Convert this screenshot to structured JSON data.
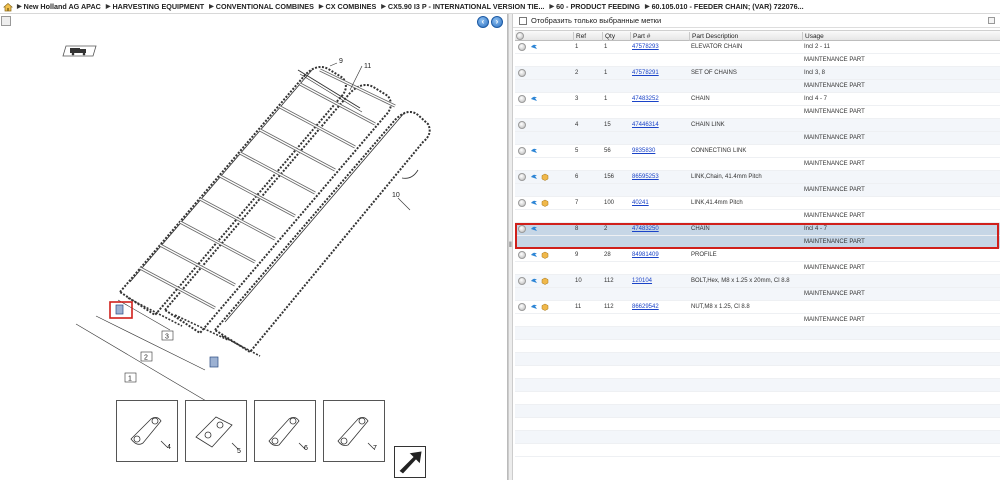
{
  "breadcrumb": [
    "New Holland AG APAC",
    "HARVESTING EQUIPMENT",
    "CONVENTIONAL COMBINES",
    "CX COMBINES",
    "CX5.90 I3 P - INTERNATIONAL VERSION TIE...",
    "60 - PRODUCT FEEDING",
    "60.105.010 - FEEDER CHAIN; (VAR) 722076..."
  ],
  "filter": {
    "label": "Отобразить только выбранные метки"
  },
  "table": {
    "columns": [
      "Ref",
      "Qty",
      "Part #",
      "Part Description",
      "Usage"
    ],
    "rows": [
      {
        "ref": "1",
        "qty": "1",
        "part": "47578293",
        "desc": "ELEVATOR CHAIN",
        "usage": "Incl 2 - 11",
        "note2": "MAINTENANCE PART",
        "icons": [
          "note"
        ]
      },
      {
        "ref": "2",
        "qty": "1",
        "part": "47578291",
        "desc": "SET OF CHAINS",
        "usage": "Incl 3, 8",
        "note2": "MAINTENANCE PART",
        "icons": []
      },
      {
        "ref": "3",
        "qty": "1",
        "part": "47483252",
        "desc": "CHAIN",
        "usage": "Incl 4 - 7",
        "note2": "MAINTENANCE PART",
        "icons": [
          "note"
        ]
      },
      {
        "ref": "4",
        "qty": "15",
        "part": "47446314",
        "desc": "CHAIN LINK",
        "usage": "",
        "note2": "MAINTENANCE PART",
        "icons": []
      },
      {
        "ref": "5",
        "qty": "56",
        "part": "9835830",
        "desc": "CONNECTING LINK",
        "usage": "",
        "note2": "MAINTENANCE PART",
        "icons": [
          "note"
        ]
      },
      {
        "ref": "6",
        "qty": "156",
        "part": "86595253",
        "desc": "LINK,Chain, 41.4mm Pitch",
        "usage": "",
        "note2": "MAINTENANCE PART",
        "icons": [
          "note",
          "pkg"
        ]
      },
      {
        "ref": "7",
        "qty": "100",
        "part": "40241",
        "desc": "LINK,41.4mm Pitch",
        "usage": "",
        "note2": "MAINTENANCE PART",
        "icons": [
          "note",
          "pkg"
        ]
      },
      {
        "ref": "8",
        "qty": "2",
        "part": "47483250",
        "desc": "CHAIN",
        "usage": "Incl 4 - 7",
        "note2": "MAINTENANCE PART",
        "icons": [
          "note"
        ],
        "selected": true
      },
      {
        "ref": "9",
        "qty": "28",
        "part": "84981409",
        "desc": "PROFILE",
        "usage": "",
        "note2": "MAINTENANCE PART",
        "icons": [
          "note",
          "pkg"
        ]
      },
      {
        "ref": "10",
        "qty": "112",
        "part": "120104",
        "desc": "BOLT,Hex, M8 x 1.25 x 20mm, Cl 8.8",
        "usage": "",
        "note2": "MAINTENANCE PART",
        "icons": [
          "note",
          "pkg"
        ]
      },
      {
        "ref": "11",
        "qty": "112",
        "part": "86629542",
        "desc": "NUT,M8 x 1.25, Cl 8.8",
        "usage": "",
        "note2": "MAINTENANCE PART",
        "icons": [
          "note",
          "pkg"
        ]
      }
    ]
  },
  "drawing": {
    "callouts": [
      "1",
      "2",
      "3",
      "9",
      "10",
      "11"
    ],
    "thumbnails": [
      "4",
      "5",
      "6",
      "7"
    ]
  },
  "colors": {
    "link": "#1a43c8",
    "selection": "#c6d6e6",
    "highlight_border": "#d0201b"
  }
}
